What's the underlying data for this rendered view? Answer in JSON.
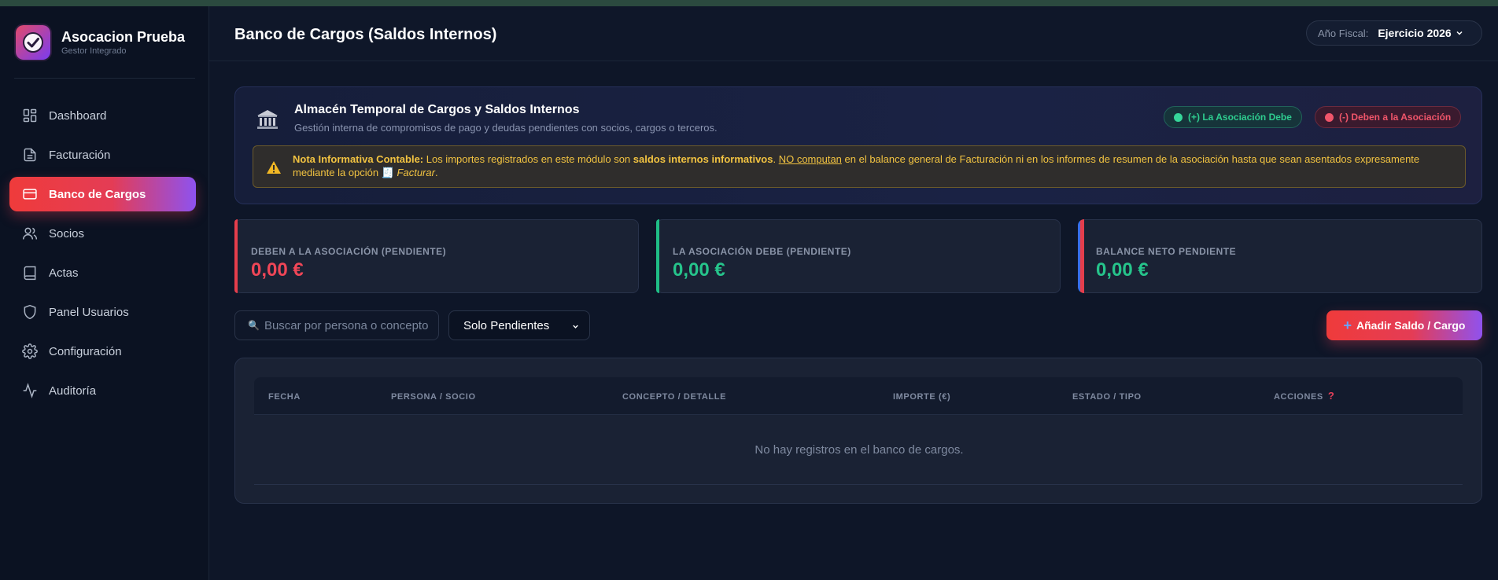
{
  "brand": {
    "title": "Asocacion Prueba",
    "subtitle": "Gestor Integrado"
  },
  "sidebar": {
    "items": [
      {
        "label": "Dashboard",
        "icon": "dashboard-icon"
      },
      {
        "label": "Facturación",
        "icon": "document-icon"
      },
      {
        "label": "Banco de Cargos",
        "icon": "card-icon",
        "active": true
      },
      {
        "label": "Socios",
        "icon": "users-icon"
      },
      {
        "label": "Actas",
        "icon": "book-icon"
      },
      {
        "label": "Panel Usuarios",
        "icon": "shield-icon"
      },
      {
        "label": "Configuración",
        "icon": "gear-icon"
      },
      {
        "label": "Auditoría",
        "icon": "activity-icon"
      }
    ]
  },
  "header": {
    "title": "Banco de Cargos (Saldos Internos)",
    "fiscal_label": "Año Fiscal:",
    "fiscal_value": "Ejercicio 2026"
  },
  "info": {
    "title": "Almacén Temporal de Cargos y Saldos Internos",
    "description": "Gestión interna de compromisos de pago y deudas pendientes con socios, cargos o terceros.",
    "legend_positive": "(+) La Asociación Debe",
    "legend_negative": "(-) Deben a la Asociación",
    "note": {
      "lead": "Nota Informativa Contable:",
      "t1": " Los importes registrados en este módulo son ",
      "b1": "saldos internos informativos",
      "t2": ". ",
      "u1": "NO computan",
      "t3": " en el balance general de Facturación ni en los informes de resumen de la asociación hasta que sean asentados expresamente mediante la opción ",
      "emoji": "🧾",
      "i1": " Facturar",
      "t4": "."
    }
  },
  "stats": [
    {
      "label": "DEBEN A LA ASOCIACIÓN (PENDIENTE)",
      "value": "0,00 €",
      "color": "#ef4657"
    },
    {
      "label": "LA ASOCIACIÓN DEBE (PENDIENTE)",
      "value": "0,00 €",
      "color": "#26c48b"
    },
    {
      "label": "BALANCE NETO PENDIENTE",
      "value": "0,00 €",
      "color": "#26c48b"
    }
  ],
  "toolbar": {
    "search_icon": "🔍",
    "search_placeholder": "Buscar por persona o concepto",
    "filter_value": "Solo Pendientes",
    "add_label": "Añadir Saldo / Cargo"
  },
  "table": {
    "columns": [
      "FECHA",
      "PERSONA / SOCIO",
      "CONCEPTO / DETALLE",
      "IMPORTE (€)",
      "ESTADO / TIPO",
      "ACCIONES"
    ],
    "help_icon": "?",
    "empty_message": "No hay registros en el banco de cargos."
  }
}
